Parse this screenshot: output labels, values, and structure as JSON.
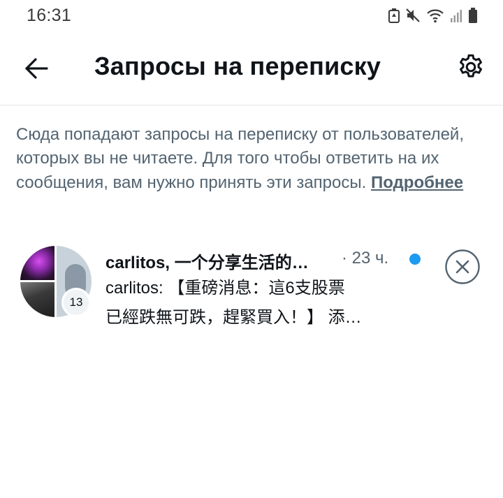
{
  "status_bar": {
    "time": "16:31",
    "icons": [
      "clean-icon",
      "mute-icon",
      "wifi-icon",
      "signal-icon",
      "battery-icon"
    ]
  },
  "header": {
    "title": "Запросы на переписку",
    "back_icon": "back-arrow-icon",
    "settings_icon": "gear-icon"
  },
  "info": {
    "text": "Сюда попадают запросы на переписку от пользователей, которых вы не читаете. Для того чтобы ответить на их сообщения, вам нужно принять эти запросы.",
    "link": "Подробнее"
  },
  "requests": [
    {
      "name": "carlitos, 一个分享生活的…",
      "time": "· 23 ч.",
      "member_count": "13",
      "preview_line1": "carlitos: 【重磅消息：這6支股票",
      "preview_line2": "已經跌無可跌，趕緊買入！】 添…",
      "unread": true
    }
  ],
  "colors": {
    "accent": "#1d9bf0",
    "secondary_text": "#536471",
    "primary_text": "#0f1419",
    "divider": "#e1e6ea"
  }
}
